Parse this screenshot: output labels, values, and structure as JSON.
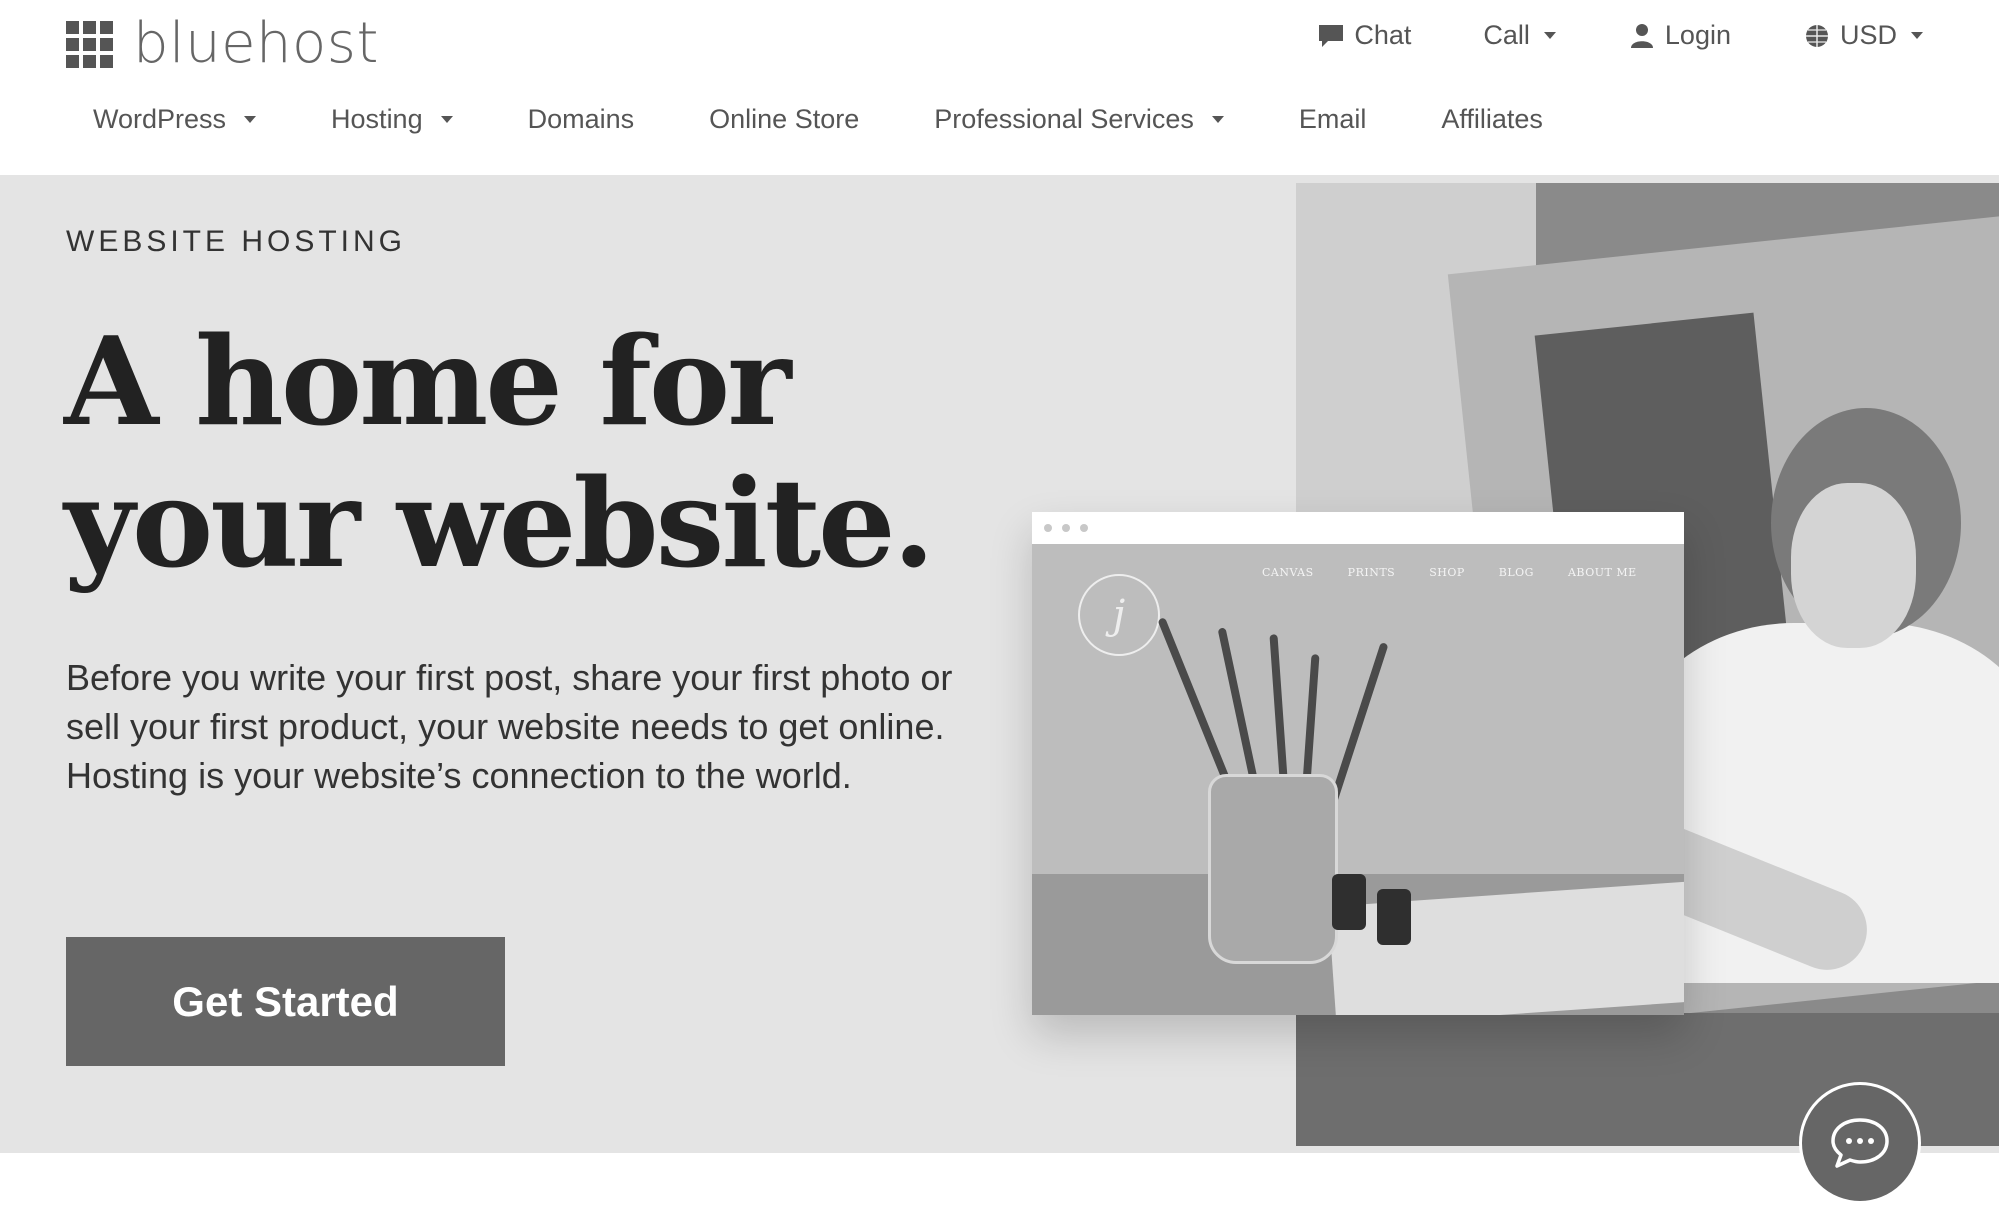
{
  "brand": {
    "name": "bluehost"
  },
  "utility_nav": {
    "chat": {
      "label": "Chat",
      "icon": "chat-bubble-icon"
    },
    "call": {
      "label": "Call",
      "icon": "chevron-down-icon"
    },
    "login": {
      "label": "Login",
      "icon": "user-icon"
    },
    "currency": {
      "label": "USD",
      "icon": "globe-icon"
    }
  },
  "main_nav": {
    "items": [
      {
        "label": "WordPress",
        "has_dropdown": true
      },
      {
        "label": "Hosting",
        "has_dropdown": true
      },
      {
        "label": "Domains",
        "has_dropdown": false
      },
      {
        "label": "Online Store",
        "has_dropdown": false
      },
      {
        "label": "Professional Services",
        "has_dropdown": true
      },
      {
        "label": "Email",
        "has_dropdown": false
      },
      {
        "label": "Affiliates",
        "has_dropdown": false
      }
    ]
  },
  "hero": {
    "eyebrow": "WEBSITE HOSTING",
    "headline_line1": "A home for",
    "headline_line2": "your website.",
    "lead": "Before you write your first post, share your first photo or sell your first product, your website needs to get online. Hosting is your website’s connection to the world.",
    "cta_label": "Get Started"
  },
  "browser_mock": {
    "menu": [
      "CANVAS",
      "PRINTS",
      "SHOP",
      "BLOG",
      "ABOUT ME"
    ],
    "logo_letter": "j"
  },
  "colors": {
    "hero_bg": "#e4e4e4",
    "cta_bg": "#666666",
    "text_dark": "#222222",
    "nav_text": "#555555"
  }
}
